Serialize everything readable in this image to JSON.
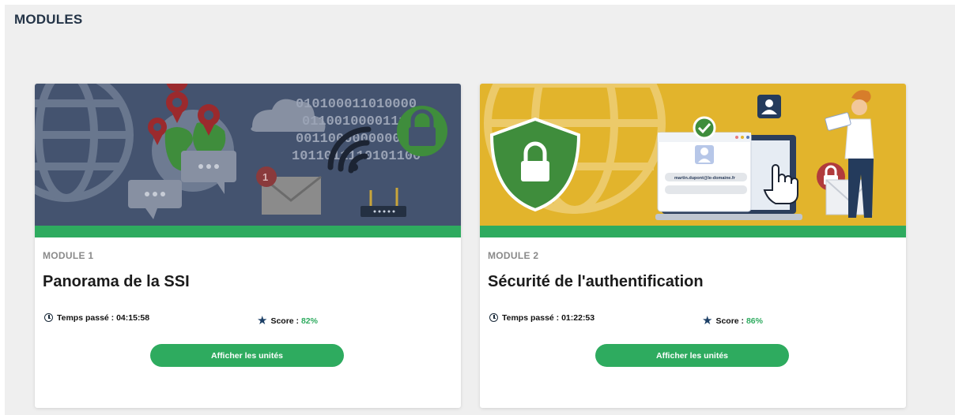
{
  "page": {
    "title": "MODULES"
  },
  "modules": [
    {
      "label": "MODULE 1",
      "title": "Panorama de la SSI",
      "time_label": "Temps passé : 04:15:58",
      "score_label": "Score : ",
      "score_value": "82%",
      "button_label": "Afficher les unités",
      "banner_color": "#44536f"
    },
    {
      "label": "MODULE 2",
      "title": "Sécurité de l'authentification",
      "time_label": "Temps passé : 01:22:53",
      "score_label": "Score : ",
      "score_value": "86%",
      "button_label": "Afficher les unités",
      "banner_color": "#e2b42c",
      "login_email": "martin.dupont@le-domaine.fr"
    }
  ],
  "binary_text": [
    "010100011010000",
    "0110010000111",
    "00110000000000",
    "1011011110101100"
  ],
  "colors": {
    "accent_green": "#2eab5f",
    "star": "#1c3f66"
  },
  "icons": [
    "globe-icon",
    "map-pin-icon",
    "chat-bubble-icon",
    "cloud-icon",
    "wifi-icon",
    "padlock-icon",
    "envelope-icon",
    "router-icon",
    "shield-icon",
    "user-icon",
    "checkmark-icon",
    "clock-icon",
    "star-icon"
  ]
}
